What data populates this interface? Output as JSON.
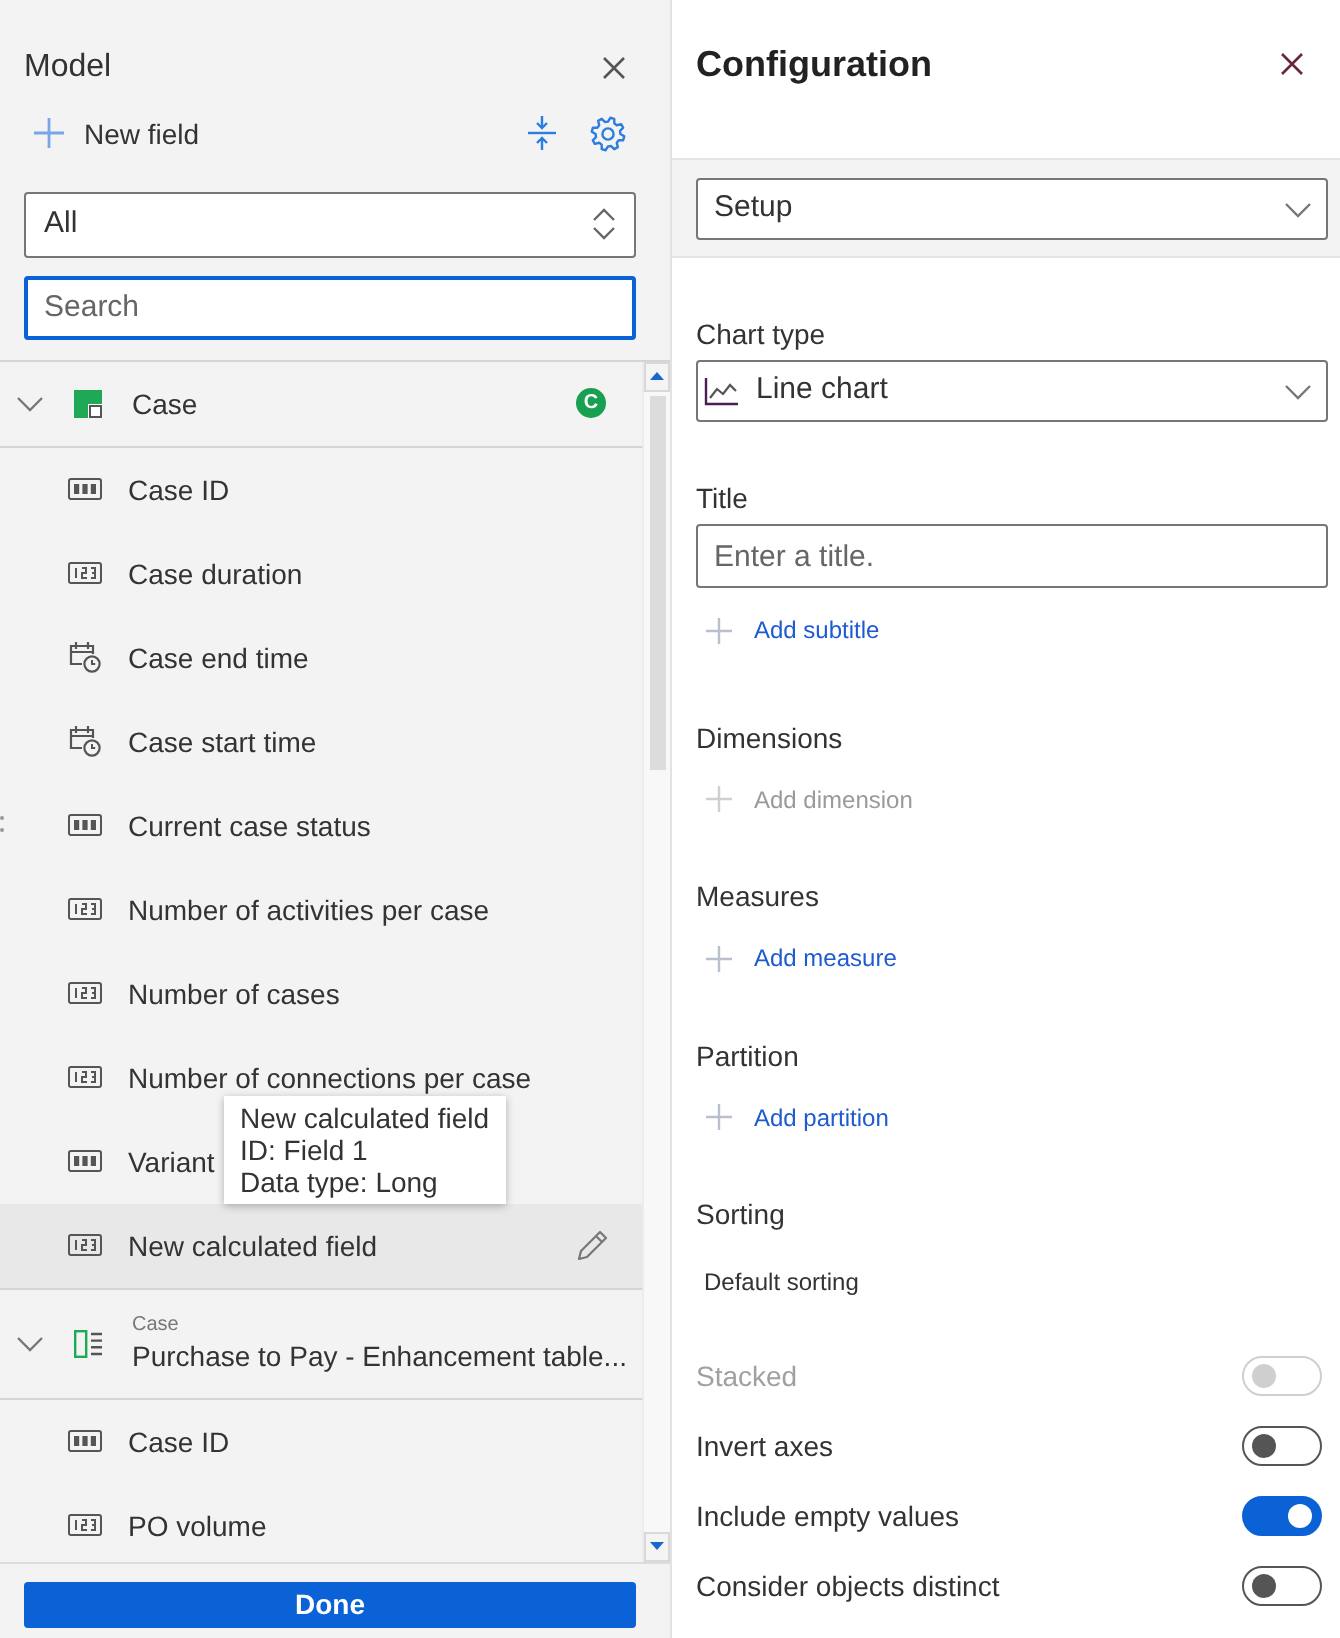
{
  "model_panel": {
    "title": "Model",
    "new_field": {
      "label": "New field"
    },
    "filter": {
      "value": "All"
    },
    "search": {
      "placeholder": "Search",
      "focused": true
    },
    "groups": [
      {
        "kind": "table",
        "name": "Case",
        "badge": "C",
        "expanded": true,
        "fields": [
          {
            "kind": "text",
            "name": "Case ID",
            "selected": false
          },
          {
            "kind": "number",
            "name": "Case duration",
            "selected": false
          },
          {
            "kind": "datetime",
            "name": "Case end time",
            "selected": false
          },
          {
            "kind": "datetime",
            "name": "Case start time",
            "selected": false
          },
          {
            "kind": "text",
            "name": "Current case status",
            "selected": false
          },
          {
            "kind": "number",
            "name": "Number of activities per case",
            "selected": false
          },
          {
            "kind": "number",
            "name": "Number of cases",
            "selected": false
          },
          {
            "kind": "number",
            "name": "Number of connections per case",
            "selected": false
          },
          {
            "kind": "text",
            "name": "Variant",
            "selected": false
          },
          {
            "kind": "number",
            "name": "New calculated field",
            "selected": true
          }
        ]
      },
      {
        "kind": "extension",
        "caption": "Case",
        "name": "Purchase to Pay - Enhancement table...",
        "expanded": true,
        "fields": [
          {
            "kind": "text",
            "name": "Case ID",
            "selected": false
          },
          {
            "kind": "number",
            "name": "PO volume",
            "selected": false
          }
        ]
      }
    ],
    "tooltip": {
      "lines": [
        "New calculated field",
        "ID: Field 1",
        "Data type: Long"
      ]
    },
    "done_button": {
      "label": "Done"
    }
  },
  "configuration_panel": {
    "title": "Configuration",
    "view_select": {
      "value": "Setup"
    },
    "chart_type": {
      "label": "Chart type",
      "value": "Line chart"
    },
    "title_field": {
      "label": "Title",
      "placeholder": "Enter a title."
    },
    "add_subtitle": {
      "label": "Add subtitle",
      "disabled": false
    },
    "sections": [
      {
        "kind": "action",
        "heading": "Dimensions",
        "action": {
          "label": "Add dimension",
          "disabled": true
        }
      },
      {
        "kind": "action",
        "heading": "Measures",
        "action": {
          "label": "Add measure",
          "disabled": false
        }
      },
      {
        "kind": "action",
        "heading": "Partition",
        "action": {
          "label": "Add partition",
          "disabled": false
        }
      },
      {
        "kind": "value",
        "heading": "Sorting",
        "value": "Default sorting"
      }
    ],
    "toggles": [
      {
        "label": "Stacked",
        "on": false,
        "disabled": true
      },
      {
        "label": "Invert axes",
        "on": false,
        "disabled": false
      },
      {
        "label": "Include empty values",
        "on": true,
        "disabled": false
      },
      {
        "label": "Consider objects distinct",
        "on": false,
        "disabled": false
      }
    ]
  }
}
